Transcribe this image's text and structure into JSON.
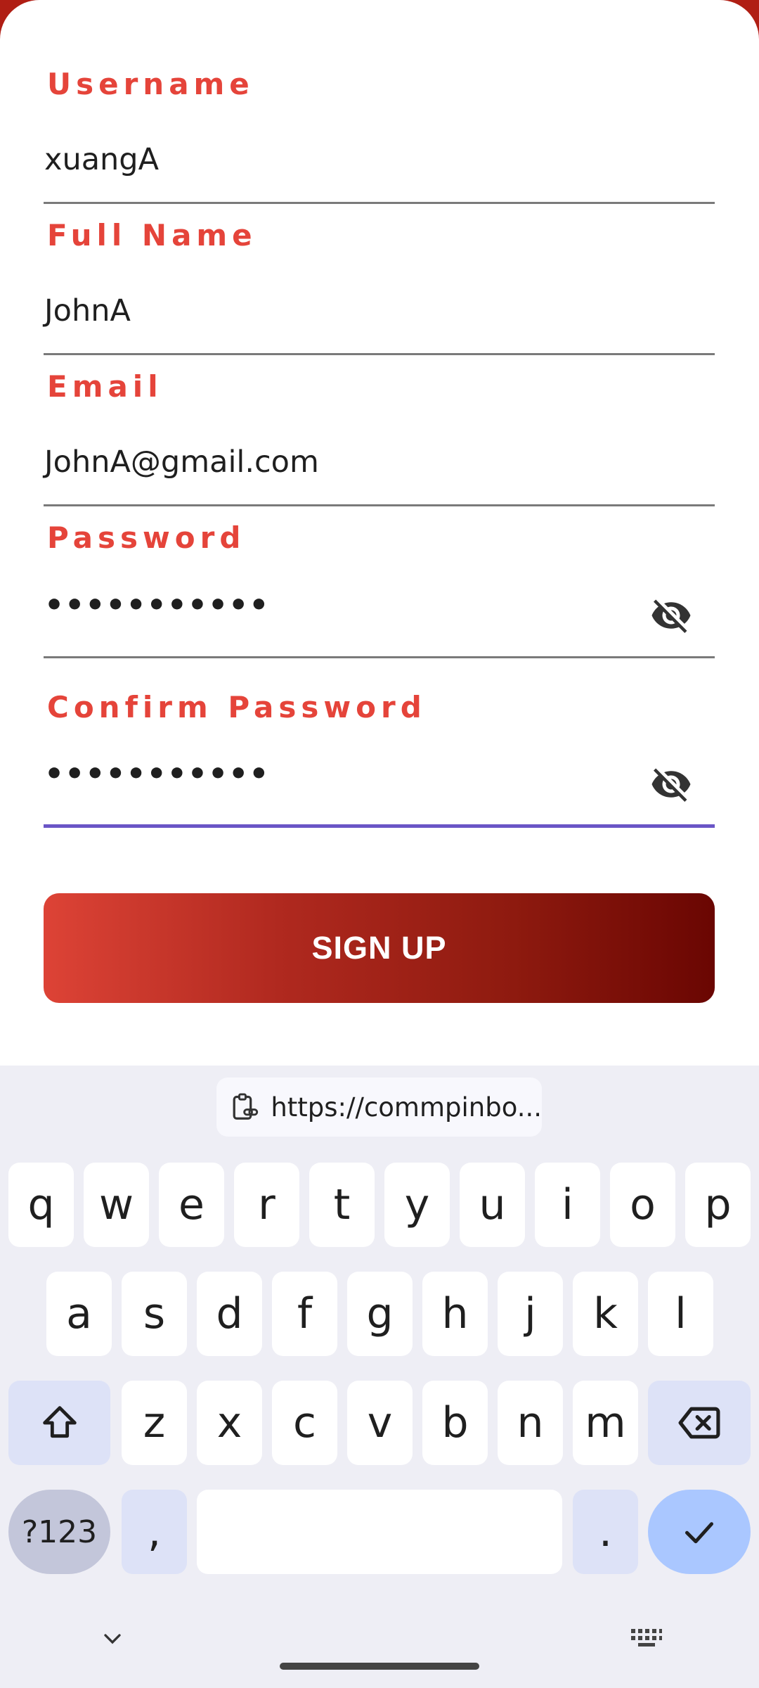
{
  "form": {
    "username": {
      "label": "Username",
      "value": "xuangA"
    },
    "fullname": {
      "label": "Full Name",
      "value": "JohnA"
    },
    "email": {
      "label": "Email",
      "value": "JohnA@gmail.com"
    },
    "password": {
      "label": "Password",
      "value": "•••••••••••"
    },
    "confirm_password": {
      "label": "Confirm Password",
      "value": "•••••••••••"
    },
    "signup_label": "SIGN UP"
  },
  "keyboard": {
    "clipboard_text": "https://commpinbo...",
    "row1": [
      "q",
      "w",
      "e",
      "r",
      "t",
      "y",
      "u",
      "i",
      "o",
      "p"
    ],
    "row2": [
      "a",
      "s",
      "d",
      "f",
      "g",
      "h",
      "j",
      "k",
      "l"
    ],
    "row3": [
      "z",
      "x",
      "c",
      "v",
      "b",
      "n",
      "m"
    ],
    "symbols_label": "?123",
    "comma_label": ",",
    "period_label": ".",
    "icons": {
      "shift": "shift-icon",
      "backspace": "backspace-icon",
      "enter": "checkmark-icon",
      "hide": "chevron-down-icon",
      "switch": "keyboard-icon",
      "clipboard": "clipboard-link-icon"
    }
  },
  "colors": {
    "label": "#e5443a",
    "focus_underline": "#6a55c6",
    "button_start": "#dd4336",
    "button_end": "#6a0602",
    "keyboard_bg": "#eeeef5"
  }
}
